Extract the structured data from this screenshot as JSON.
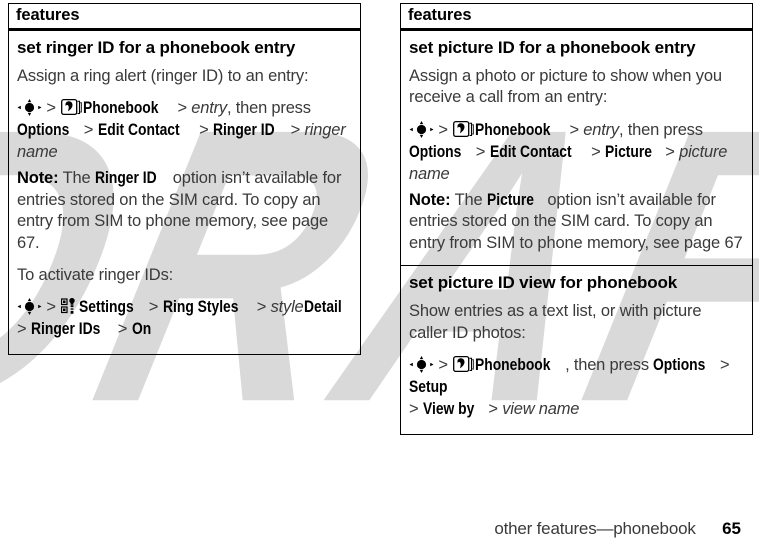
{
  "document": {
    "watermark": "DRAFT",
    "footer": {
      "section_label": "other features—phonebook",
      "page_number": "65"
    }
  },
  "icons": {
    "nav_key": "navigation-key-icon",
    "phonebook": "phonebook-icon",
    "settings": "settings-icon"
  },
  "columns": [
    {
      "header": "features",
      "rows": [
        {
          "title": "set ringer ID for a phonebook entry",
          "blocks": [
            {
              "type": "paragraph",
              "text": "Assign a ring alert (ringer ID) to an entry:"
            },
            {
              "type": "path",
              "segments": [
                {
                  "kind": "icon",
                  "icon": "nav_key"
                },
                {
                  "kind": "sep",
                  "text": ">"
                },
                {
                  "kind": "icon",
                  "icon": "phonebook"
                },
                {
                  "kind": "menu",
                  "text": "Phonebook"
                },
                {
                  "kind": "sep",
                  "text": ">"
                },
                {
                  "kind": "italic",
                  "text": "entry"
                },
                {
                  "kind": "plain",
                  "text": ", then press"
                },
                {
                  "kind": "break"
                },
                {
                  "kind": "menu",
                  "text": "Options"
                },
                {
                  "kind": "sep",
                  "text": ">"
                },
                {
                  "kind": "menu",
                  "text": "Edit Contact"
                },
                {
                  "kind": "sep",
                  "text": ">"
                },
                {
                  "kind": "menu",
                  "text": "Ringer ID"
                },
                {
                  "kind": "sep",
                  "text": ">"
                },
                {
                  "kind": "italic",
                  "text": "ringer name"
                }
              ]
            },
            {
              "type": "note",
              "label": "Note:",
              "segments": [
                {
                  "kind": "plain",
                  "text": "The "
                },
                {
                  "kind": "menu",
                  "text": "Ringer ID"
                },
                {
                  "kind": "plain",
                  "text": " option isn’t available for entries stored on the SIM card. To copy an entry from SIM to phone memory, see page 67."
                }
              ]
            },
            {
              "type": "paragraph",
              "text": "To activate ringer IDs:"
            },
            {
              "type": "path",
              "segments": [
                {
                  "kind": "icon",
                  "icon": "nav_key"
                },
                {
                  "kind": "sep",
                  "text": ">"
                },
                {
                  "kind": "icon",
                  "icon": "settings"
                },
                {
                  "kind": "menu",
                  "text": "Settings"
                },
                {
                  "kind": "sep",
                  "text": ">"
                },
                {
                  "kind": "menu",
                  "text": "Ring Styles"
                },
                {
                  "kind": "sep",
                  "text": ">"
                },
                {
                  "kind": "italic",
                  "text": "style"
                },
                {
                  "kind": "menu",
                  "text": "Detail"
                },
                {
                  "kind": "break"
                },
                {
                  "kind": "sep",
                  "text": ">"
                },
                {
                  "kind": "menu",
                  "text": "Ringer IDs"
                },
                {
                  "kind": "sep",
                  "text": ">"
                },
                {
                  "kind": "menu",
                  "text": "On"
                }
              ]
            }
          ]
        }
      ]
    },
    {
      "header": "features",
      "rows": [
        {
          "title": "set picture ID for a phonebook entry",
          "blocks": [
            {
              "type": "paragraph",
              "text": "Assign a photo or picture to show when you receive a call from an entry:"
            },
            {
              "type": "path",
              "segments": [
                {
                  "kind": "icon",
                  "icon": "nav_key"
                },
                {
                  "kind": "sep",
                  "text": ">"
                },
                {
                  "kind": "icon",
                  "icon": "phonebook"
                },
                {
                  "kind": "menu",
                  "text": "Phonebook"
                },
                {
                  "kind": "sep",
                  "text": ">"
                },
                {
                  "kind": "italic",
                  "text": "entry"
                },
                {
                  "kind": "plain",
                  "text": ", then press"
                },
                {
                  "kind": "break"
                },
                {
                  "kind": "menu",
                  "text": "Options"
                },
                {
                  "kind": "sep",
                  "text": ">"
                },
                {
                  "kind": "menu",
                  "text": "Edit Contact"
                },
                {
                  "kind": "sep",
                  "text": ">"
                },
                {
                  "kind": "menu",
                  "text": "Picture"
                },
                {
                  "kind": "sep",
                  "text": ">"
                },
                {
                  "kind": "italic",
                  "text": "picture name"
                }
              ]
            },
            {
              "type": "note",
              "label": "Note:",
              "segments": [
                {
                  "kind": "plain",
                  "text": "The "
                },
                {
                  "kind": "menu",
                  "text": "Picture"
                },
                {
                  "kind": "plain",
                  "text": " option isn’t available for entries stored on the SIM card. To copy an entry from SIM to phone memory, see page 67"
                }
              ]
            }
          ]
        },
        {
          "title": "set picture ID view for phonebook",
          "divider_above": true,
          "blocks": [
            {
              "type": "paragraph",
              "text": "Show entries as a text list, or with picture caller ID photos:"
            },
            {
              "type": "path",
              "segments": [
                {
                  "kind": "icon",
                  "icon": "nav_key"
                },
                {
                  "kind": "sep",
                  "text": ">"
                },
                {
                  "kind": "icon",
                  "icon": "phonebook"
                },
                {
                  "kind": "menu",
                  "text": "Phonebook"
                },
                {
                  "kind": "plain",
                  "text": ", then press "
                },
                {
                  "kind": "menu",
                  "text": "Options"
                },
                {
                  "kind": "sep",
                  "text": ">"
                },
                {
                  "kind": "menu",
                  "text": "Setup"
                },
                {
                  "kind": "break"
                },
                {
                  "kind": "sep",
                  "text": ">"
                },
                {
                  "kind": "menu",
                  "text": "View by"
                },
                {
                  "kind": "sep",
                  "text": ">"
                },
                {
                  "kind": "italic",
                  "text": "view name"
                }
              ]
            }
          ]
        }
      ]
    }
  ]
}
